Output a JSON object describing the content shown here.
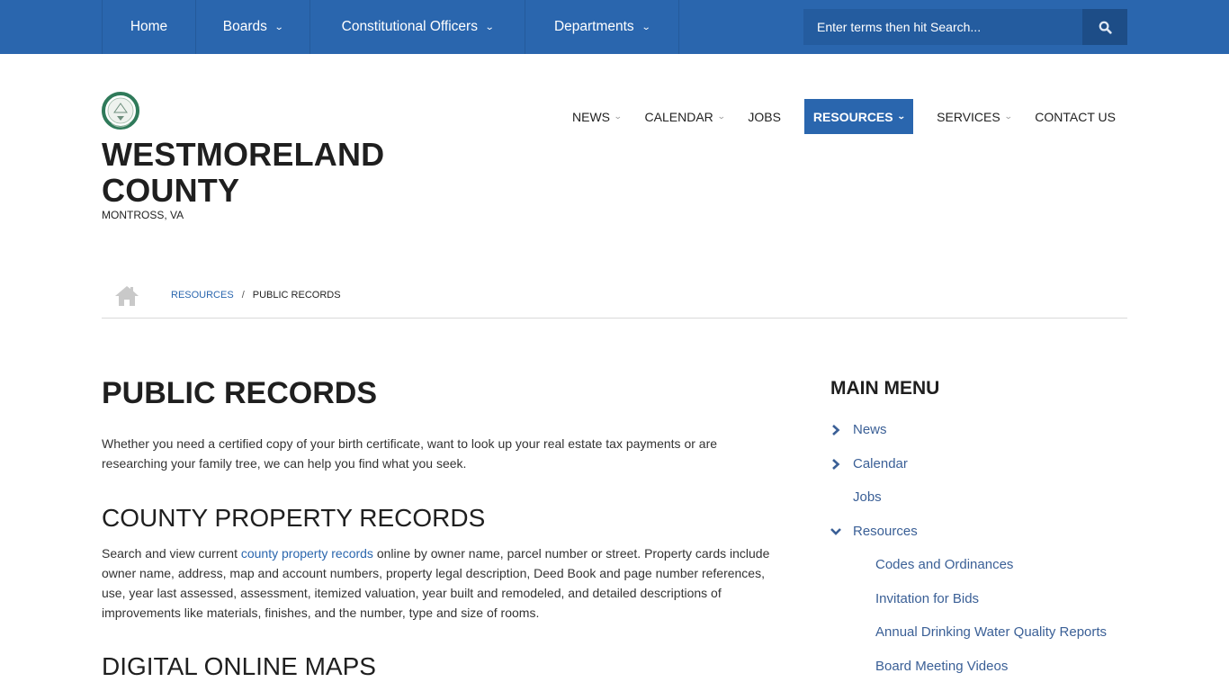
{
  "top_nav": {
    "items": [
      {
        "label": "Home",
        "has_dropdown": false
      },
      {
        "label": "Boards",
        "has_dropdown": true
      },
      {
        "label": "Constitutional Officers",
        "has_dropdown": true
      },
      {
        "label": "Departments",
        "has_dropdown": true
      }
    ],
    "caret": "⌄"
  },
  "search": {
    "placeholder": "Enter terms then hit Search...",
    "value": "",
    "button_icon": "search-icon"
  },
  "brand": {
    "seal_icon": "county-seal-logo",
    "title_line1": "WESTMORELAND",
    "title_line2": "COUNTY",
    "subtitle": "MONTROSS, VA"
  },
  "main_nav": {
    "items": [
      {
        "label": "NEWS",
        "caret": "⌄",
        "active": false
      },
      {
        "label": "CALENDAR",
        "caret": "⌄",
        "active": false
      },
      {
        "label": "JOBS",
        "caret": "",
        "active": false
      },
      {
        "label": "RESOURCES",
        "caret": "⌄",
        "active": true
      },
      {
        "label": "SERVICES",
        "caret": "⌄",
        "active": false
      },
      {
        "label": "CONTACT US",
        "caret": "",
        "active": false
      }
    ],
    "active_color": "#2a66ae"
  },
  "breadcrumb": {
    "home_icon": "home-icon",
    "items": [
      {
        "label": "RESOURCES",
        "link": true
      },
      {
        "label": "PUBLIC RECORDS",
        "link": false
      }
    ],
    "separator": "/"
  },
  "content": {
    "title": "PUBLIC RECORDS",
    "intro": "Whether you need a certified copy of your birth certificate, want to look up your real estate tax payments or are researching your family tree, we can help you find what you seek.",
    "sections": [
      {
        "heading": "COUNTY PROPERTY RECORDS",
        "text_before_link": "Search and view current ",
        "link_text": "county property records",
        "text_after_link": " online by owner name, parcel number or street. Property cards include owner name, address, map and account numbers, property legal description, Deed Book and page number references, use, year last assessed, assessment, itemized valuation, year built and remodeled, and detailed descriptions of improvements like materials, finishes, and the number, type and size of rooms."
      },
      {
        "heading": "DIGITAL ONLINE MAPS"
      }
    ]
  },
  "sidebar": {
    "title": "MAIN MENU",
    "items": [
      {
        "label": "News",
        "icon": "chevron-right-icon",
        "level": 0
      },
      {
        "label": "Calendar",
        "icon": "chevron-right-icon",
        "level": 0
      },
      {
        "label": "Jobs",
        "icon": "",
        "level": 0
      },
      {
        "label": "Resources",
        "icon": "chevron-down-icon",
        "level": 0,
        "expanded": true
      },
      {
        "label": "Codes and Ordinances",
        "level": 1
      },
      {
        "label": "Invitation for Bids",
        "level": 1
      },
      {
        "label": "Annual Drinking Water Quality Reports",
        "level": 1
      },
      {
        "label": "Board Meeting Videos",
        "level": 1
      }
    ]
  },
  "colors": {
    "primary": "#2a66ae",
    "search_bg": "#245c9f",
    "search_btn": "#1d4d87",
    "link": "#2a66ae",
    "sidebar_link": "#3a5f96"
  }
}
